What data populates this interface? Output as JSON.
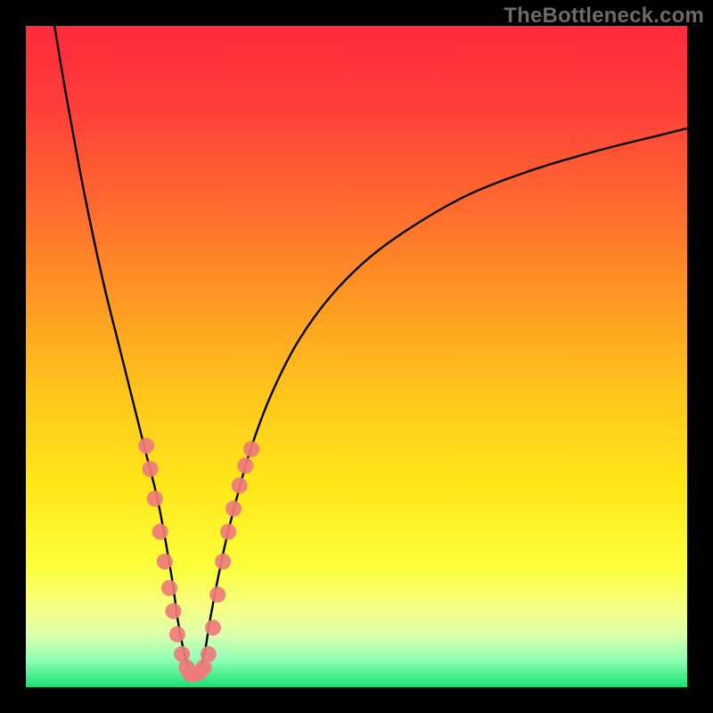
{
  "watermark": "TheBottleneck.com",
  "chart_data": {
    "type": "line",
    "title": "",
    "xlabel": "",
    "ylabel": "",
    "xlim": [
      0,
      100
    ],
    "ylim": [
      0,
      100
    ],
    "background_gradient_stops": [
      {
        "offset": 0.0,
        "color": "#ff2a3c"
      },
      {
        "offset": 0.12,
        "color": "#ff3e3a"
      },
      {
        "offset": 0.27,
        "color": "#ff6a2f"
      },
      {
        "offset": 0.42,
        "color": "#ff9a22"
      },
      {
        "offset": 0.55,
        "color": "#ffc41c"
      },
      {
        "offset": 0.7,
        "color": "#ffe81a"
      },
      {
        "offset": 0.82,
        "color": "#fbff3c"
      },
      {
        "offset": 0.88,
        "color": "#f7ff84"
      },
      {
        "offset": 0.92,
        "color": "#dcffad"
      },
      {
        "offset": 0.96,
        "color": "#8dffb5"
      },
      {
        "offset": 1.0,
        "color": "#18e070"
      }
    ],
    "series": [
      {
        "name": "bottleneck-curve",
        "color": "#000000",
        "x": [
          4.0,
          6.0,
          8.0,
          10.0,
          12.0,
          14.0,
          16.0,
          18.0,
          20.0,
          22.0,
          23.0,
          24.0,
          25.0,
          26.0,
          27.0,
          28.0,
          30.0,
          32.0,
          34.0,
          37.0,
          41.0,
          46.0,
          52.0,
          59.0,
          67.0,
          76.0,
          86.0,
          96.0,
          100.0
        ],
        "y": [
          102.0,
          90.0,
          79.0,
          69.0,
          60.0,
          52.0,
          44.0,
          36.0,
          28.0,
          17.0,
          10.0,
          5.0,
          2.0,
          2.0,
          5.0,
          11.0,
          21.0,
          29.0,
          36.0,
          44.0,
          52.0,
          59.0,
          65.0,
          70.0,
          74.5,
          78.0,
          81.0,
          83.5,
          84.5
        ]
      }
    ],
    "marker_clusters": [
      {
        "name": "left-arm-markers",
        "color": "#ef7b7b",
        "points": [
          {
            "x": 18.2,
            "y": 36.5
          },
          {
            "x": 18.8,
            "y": 33.0
          },
          {
            "x": 19.5,
            "y": 28.5
          },
          {
            "x": 20.3,
            "y": 23.5
          },
          {
            "x": 21.0,
            "y": 19.0
          },
          {
            "x": 21.7,
            "y": 15.0
          },
          {
            "x": 22.3,
            "y": 11.5
          },
          {
            "x": 22.9,
            "y": 8.0
          },
          {
            "x": 23.6,
            "y": 5.0
          },
          {
            "x": 24.3,
            "y": 3.0
          }
        ]
      },
      {
        "name": "trough-markers",
        "color": "#ef7b7b",
        "points": [
          {
            "x": 24.8,
            "y": 2.0
          },
          {
            "x": 25.5,
            "y": 2.0
          },
          {
            "x": 26.2,
            "y": 2.2
          },
          {
            "x": 26.9,
            "y": 3.0
          },
          {
            "x": 27.6,
            "y": 5.0
          }
        ]
      },
      {
        "name": "right-arm-markers",
        "color": "#ef7b7b",
        "points": [
          {
            "x": 28.3,
            "y": 9.0
          },
          {
            "x": 29.0,
            "y": 14.0
          },
          {
            "x": 29.8,
            "y": 19.0
          },
          {
            "x": 30.6,
            "y": 23.5
          },
          {
            "x": 31.4,
            "y": 27.0
          },
          {
            "x": 32.3,
            "y": 30.5
          },
          {
            "x": 33.2,
            "y": 33.5
          },
          {
            "x": 34.1,
            "y": 36.0
          }
        ]
      }
    ]
  }
}
